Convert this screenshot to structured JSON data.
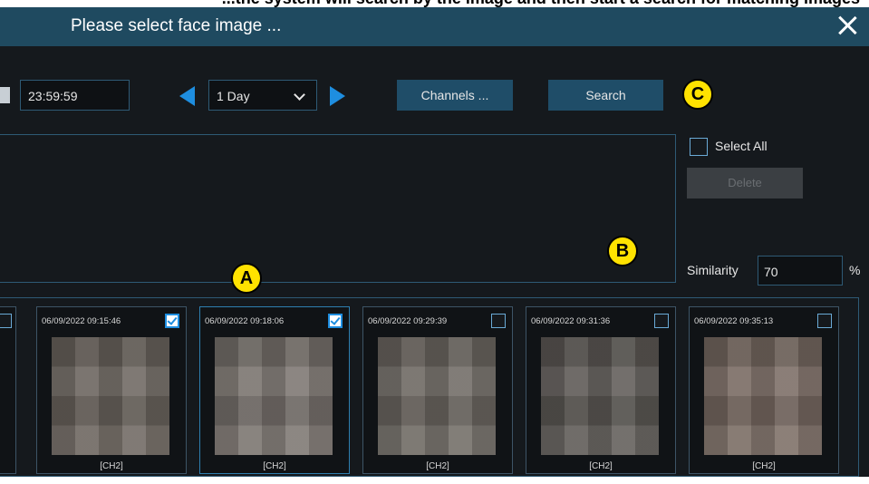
{
  "header_strip": "...the system will search by the image and then start a search for matching images",
  "window": {
    "title": "Please select face image ..."
  },
  "toolbar": {
    "time_value": "23:59:59",
    "period_value": "1 Day",
    "channels_label": "Channels ...",
    "search_label": "Search"
  },
  "callouts": {
    "a": "A",
    "b": "B",
    "c": "C"
  },
  "side": {
    "select_all_label": "Select All",
    "delete_label": "Delete",
    "similarity_label": "Similarity",
    "similarity_value": "70",
    "similarity_unit": "%"
  },
  "cards": [
    {
      "timestamp": "06/09/2022 09:15:46",
      "channel": "[CH2]",
      "checked": true
    },
    {
      "timestamp": "06/09/2022 09:18:06",
      "channel": "[CH2]",
      "checked": true
    },
    {
      "timestamp": "06/09/2022 09:29:39",
      "channel": "[CH2]",
      "checked": false
    },
    {
      "timestamp": "06/09/2022 09:31:36",
      "channel": "[CH2]",
      "checked": false
    },
    {
      "timestamp": "06/09/2022 09:35:13",
      "channel": "[CH2]",
      "checked": false
    }
  ],
  "colors": {
    "accent": "#1e8ee0",
    "titlebar": "#1f4a60",
    "background": "#15191d",
    "badge": "#ffe200"
  }
}
